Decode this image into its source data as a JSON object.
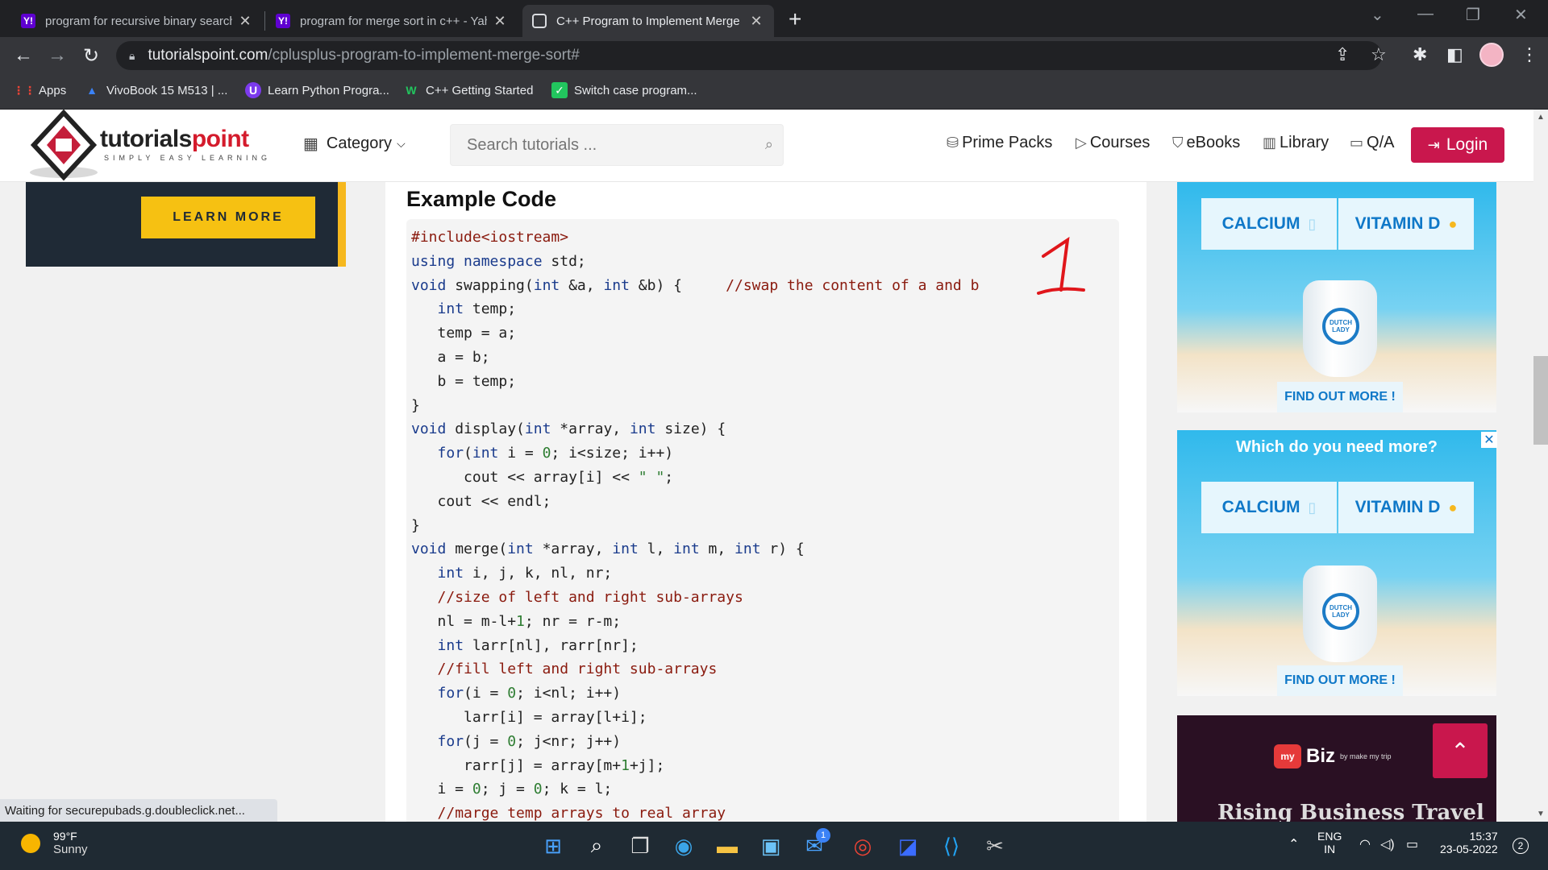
{
  "browser": {
    "tabs": [
      {
        "title": "program for recursive binary search",
        "favicon": "Y!"
      },
      {
        "title": "program for merge sort in c++ - Yahoo",
        "favicon": "Y!"
      },
      {
        "title": "C++ Program to Implement Merge Sort",
        "favicon": "tutorialspoint"
      }
    ],
    "url_host": "tutorialspoint.com",
    "url_path": "/cplusplus-program-to-implement-merge-sort#",
    "bookmarks": [
      "Apps",
      "VivoBook 15 M513 | ...",
      "Learn Python Progra...",
      "C++ Getting Started",
      "Switch case program..."
    ],
    "status_text": "Waiting for securepubads.g.doubleclick.net..."
  },
  "site": {
    "logo_main": "tutorials",
    "logo_accent": "point",
    "logo_tag": "SIMPLY EASY LEARNING",
    "category_label": "Category",
    "search_placeholder": "Search tutorials ...",
    "nav": [
      "Prime Packs",
      "Courses",
      "eBooks",
      "Library",
      "Q/A"
    ],
    "login_label": "Login",
    "learn_more": "LEARN MORE"
  },
  "content": {
    "heading": "Example Code",
    "handwritten_mark": "1"
  },
  "ads": {
    "calcium": "CALCIUM",
    "vitamin_d": "VITAMIN D",
    "find_out": "FIND OUT MORE !",
    "seal": "DUTCH LADY",
    "headline": "Which do you need more?",
    "biz_brand": "Biz",
    "biz_by": "by make my trip",
    "biz_tagline": "Rising Business Travel"
  },
  "taskbar": {
    "temperature": "99°F",
    "condition": "Sunny",
    "lang_1": "ENG",
    "lang_2": "IN",
    "time": "15:37",
    "date": "23-05-2022",
    "notifications": "2",
    "mail_badge": "1"
  }
}
